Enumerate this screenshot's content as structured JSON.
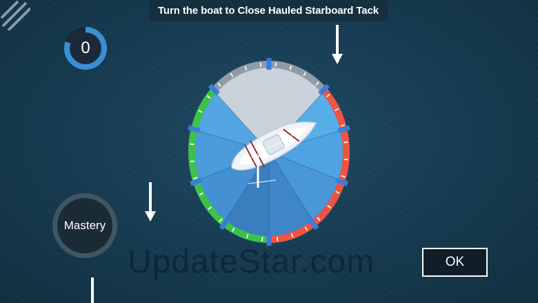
{
  "instruction": "Turn the boat to Close Hauled Starboard Tack",
  "score": {
    "value": "0",
    "progress": 0.8
  },
  "buttons": {
    "mastery": "Mastery",
    "ok": "OK"
  },
  "watermark": "UpdateStar.com",
  "colors": {
    "no_go_zone": "#8f9ba5",
    "starboard_zone": "#f0533f",
    "port_zone": "#3cc24a",
    "tick_marker": "#3b7bdf",
    "water_light": "#5fb4ee",
    "water_dark": "#3d85c6",
    "score_ring": "#3a8fd6"
  },
  "icons": {
    "menu": "diagonal-hatch-icon",
    "arrows": "down-arrow-icon",
    "boat": "sailboat-icon"
  }
}
